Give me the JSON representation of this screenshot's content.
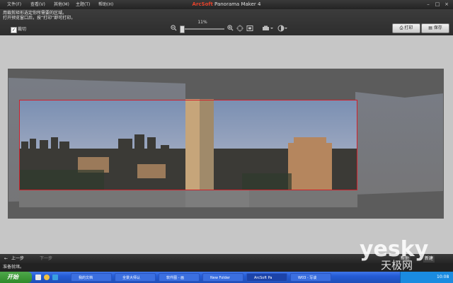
{
  "menu": [
    {
      "label": "文件(F)"
    },
    {
      "label": "查看(V)"
    },
    {
      "label": "其他(M)"
    },
    {
      "label": "主题(T)"
    },
    {
      "label": "帮助(H)"
    }
  ],
  "app_title": {
    "brand": "ArcSoft",
    "rest": "Panorama Maker 4"
  },
  "window_controls": {
    "minimize": "–",
    "maximize": "□",
    "close": "×"
  },
  "instructions": {
    "line1": "用裁剪矩形选定你所需要的区域。",
    "line2": "打开预览窗口后，按“打印”即可打印。"
  },
  "crop": {
    "label": "裁切",
    "checked": true,
    "check_mark": "✓"
  },
  "zoom": {
    "label": "11%",
    "level": 0.03
  },
  "toolbar_icons": {
    "zoom_out": "zoom-out-icon",
    "zoom_in": "zoom-in-icon",
    "fit": "fit-window-icon",
    "actual_size": "actual-size-icon",
    "rotate": "rotate-icon",
    "adjust": "adjust-icon"
  },
  "buttons": {
    "print": "打印",
    "save": "保存"
  },
  "nav": {
    "back": "上一步",
    "back_arrow": "←",
    "forward": "下一步",
    "next": "新建",
    "help": "帮助"
  },
  "status_text": "准备就绪。",
  "taskbar": {
    "start": "开始",
    "items": [
      {
        "label": "我的文档"
      },
      {
        "label": "全景大师认"
      },
      {
        "label": "软件图 - 画"
      },
      {
        "label": "New Folder"
      },
      {
        "label": "ArcSoft Pa"
      },
      {
        "label": "W03 - 写谈"
      }
    ],
    "clock": "10:08"
  },
  "watermark": {
    "main": "yesky",
    "sub": "天极网"
  },
  "colors": {
    "crop_border": "#d0202a",
    "brand": "#e8432c",
    "taskbar": "#245bd4",
    "start": "#2f8a2a"
  }
}
